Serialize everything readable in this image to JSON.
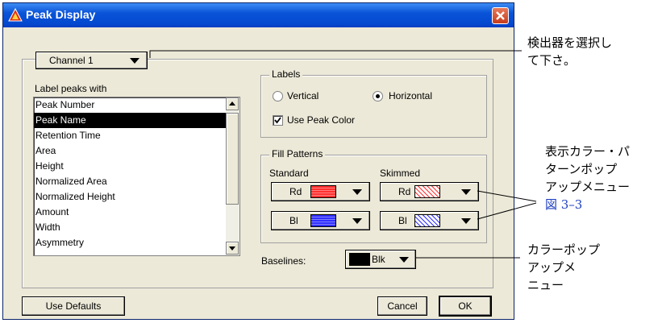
{
  "window": {
    "title": "Peak Display"
  },
  "channel": {
    "value": "Channel 1"
  },
  "label_peaks": {
    "heading": "Label peaks with",
    "items": [
      "Peak Number",
      "Peak Name",
      "Retention Time",
      "Area",
      "Height",
      "Normalized Area",
      "Normalized Height",
      "Amount",
      "Width",
      "Asymmetry"
    ],
    "selected": "Peak Name"
  },
  "labels": {
    "heading": "Labels",
    "vertical": "Vertical",
    "horizontal": "Horizontal",
    "orientation_selected": "Horizontal",
    "use_peak_color": "Use Peak Color",
    "use_peak_color_checked": true
  },
  "fill_patterns": {
    "heading": "Fill Patterns",
    "standard_label": "Standard",
    "skimmed_label": "Skimmed",
    "standard_top": {
      "text": "Rd",
      "color": "#ff3030"
    },
    "skimmed_top": {
      "text": "Rd",
      "color": "#ff3030"
    },
    "standard_bottom": {
      "text": "Bl",
      "color": "#3030ff"
    },
    "skimmed_bottom": {
      "text": "Bl",
      "color": "#3030ff"
    }
  },
  "baselines": {
    "label": "Baselines:",
    "value": "Blk",
    "color": "#000000"
  },
  "buttons": {
    "use_defaults": "Use Defaults",
    "cancel": "Cancel",
    "ok": "OK"
  },
  "annotations": {
    "detector": [
      "検出器を選択し",
      "て下さ。"
    ],
    "color_pattern": [
      "表示カラー・パ",
      "ターンポップ",
      "アップメニュー"
    ],
    "figure_ref": "図 3–3",
    "color_popup": [
      "カラーポップ",
      "アップメ",
      "ニュー"
    ]
  }
}
